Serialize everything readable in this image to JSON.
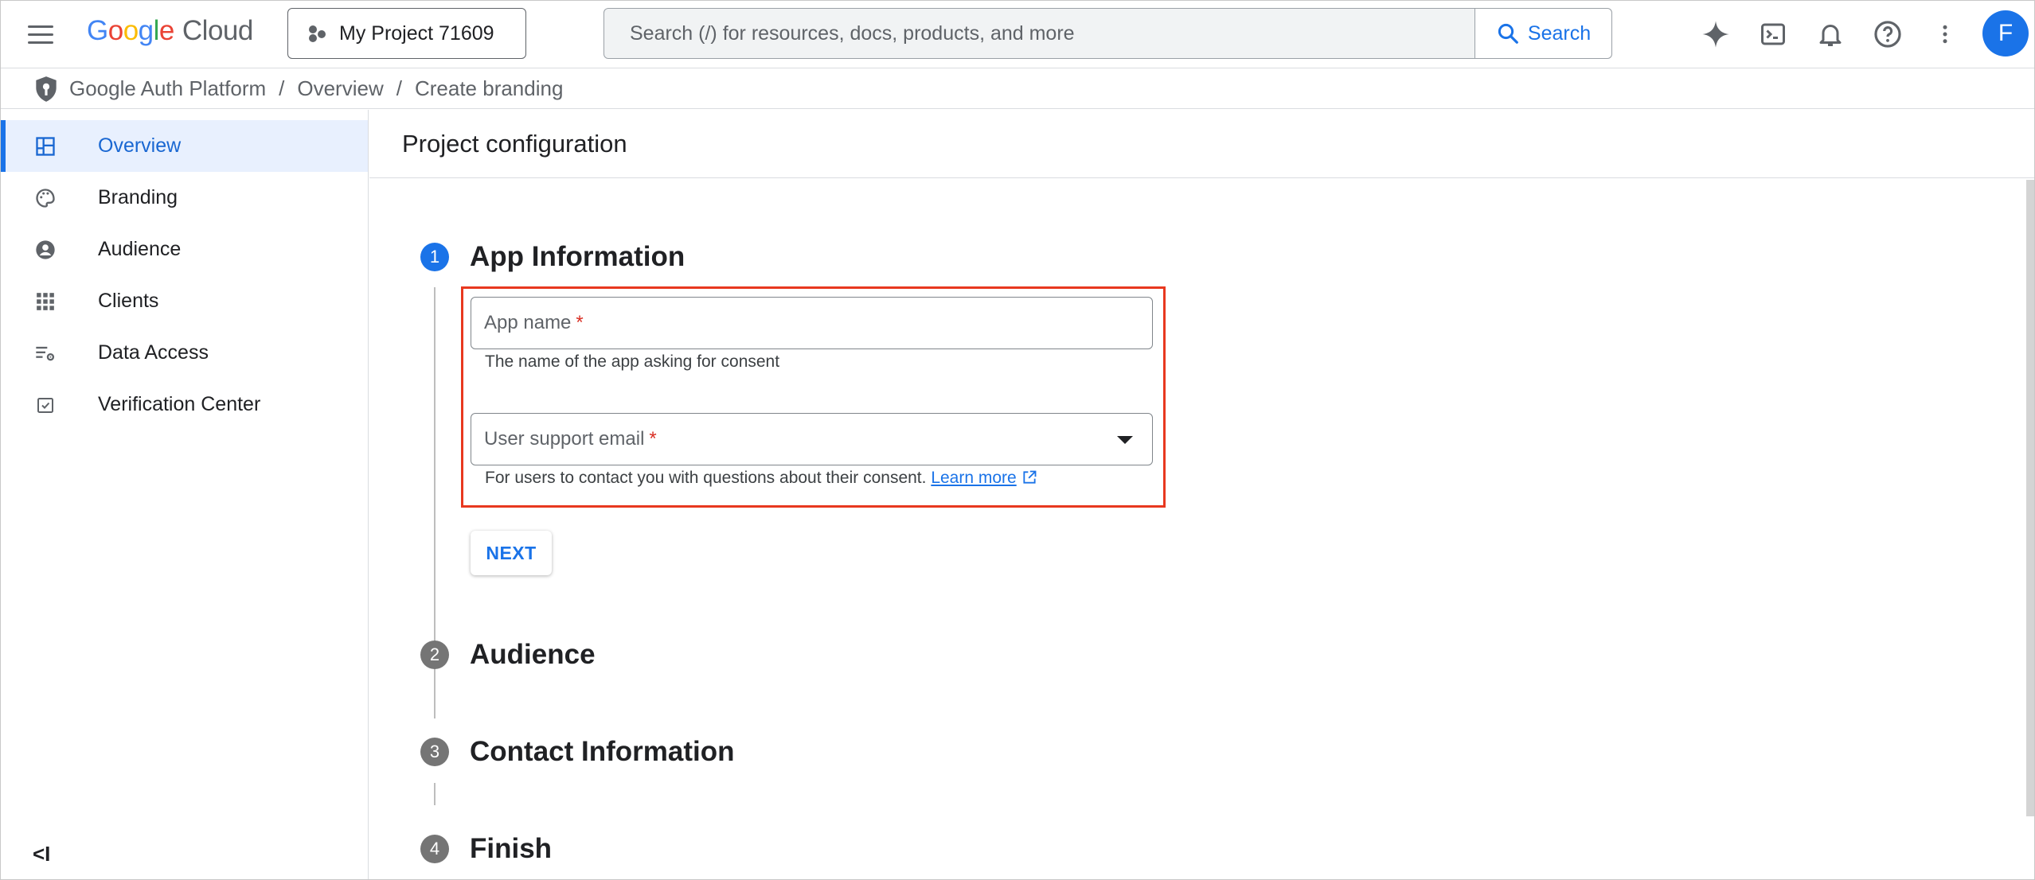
{
  "header": {
    "logo_google": [
      "G",
      "o",
      "o",
      "g",
      "l",
      "e"
    ],
    "logo_cloud": "Cloud",
    "project_name": "My Project 71609",
    "search_placeholder": "Search (/) for resources, docs, products, and more",
    "search_button": "Search",
    "avatar_initial": "F"
  },
  "breadcrumb": {
    "items": [
      "Google Auth Platform",
      "Overview",
      "Create branding"
    ],
    "separator": "/"
  },
  "sidebar": {
    "items": [
      {
        "label": "Overview",
        "icon": "dashboard-icon",
        "active": true
      },
      {
        "label": "Branding",
        "icon": "palette-icon",
        "active": false
      },
      {
        "label": "Audience",
        "icon": "account-circle-icon",
        "active": false
      },
      {
        "label": "Clients",
        "icon": "apps-grid-icon",
        "active": false
      },
      {
        "label": "Data Access",
        "icon": "list-settings-icon",
        "active": false
      },
      {
        "label": "Verification Center",
        "icon": "checkbox-icon",
        "active": false
      }
    ],
    "collapse_label": "<I"
  },
  "main": {
    "title": "Project configuration",
    "steps": [
      {
        "number": "1",
        "title": "App Information",
        "active": true
      },
      {
        "number": "2",
        "title": "Audience",
        "active": false
      },
      {
        "number": "3",
        "title": "Contact Information",
        "active": false
      },
      {
        "number": "4",
        "title": "Finish",
        "active": false
      }
    ],
    "app_name_label": "App name",
    "app_name_hint": "The name of the app asking for consent",
    "support_email_label": "User support email",
    "support_email_hint": "For users to contact you with questions about their consent.",
    "learn_more": "Learn more",
    "required_mark": "*",
    "next_button": "NEXT"
  },
  "colors": {
    "accent": "#1a73e8",
    "highlight_border": "#e8381f",
    "required": "#d93025"
  }
}
